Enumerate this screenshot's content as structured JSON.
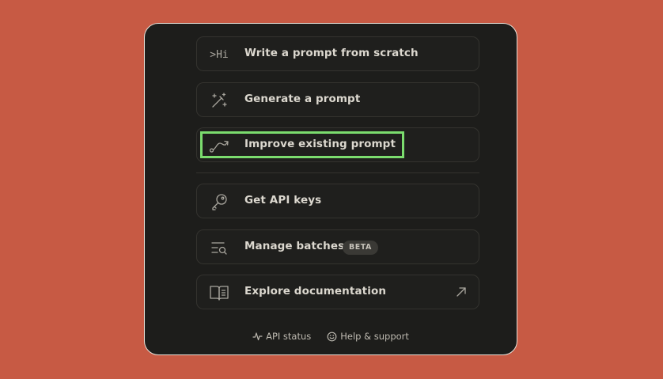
{
  "menu": {
    "items": [
      {
        "label": "Write a prompt from scratch",
        "icon": "terminal-hi-icon",
        "icon_text": ">Hi"
      },
      {
        "label": "Generate a prompt",
        "icon": "magic-wand-icon"
      },
      {
        "label": "Improve existing prompt",
        "icon": "curve-arrow-icon",
        "highlighted": true
      },
      {
        "label": "Get API keys",
        "icon": "key-icon"
      },
      {
        "label": "Manage batches",
        "icon": "list-search-icon",
        "badge": "BETA"
      },
      {
        "label": "Explore documentation",
        "icon": "book-icon",
        "trailing_icon": "external-arrow-icon"
      }
    ]
  },
  "footer": {
    "api_status": "API status",
    "help": "Help & support"
  },
  "colors": {
    "background": "#c75a44",
    "card": "#1d1d1b",
    "highlight": "#7bdc6e"
  }
}
